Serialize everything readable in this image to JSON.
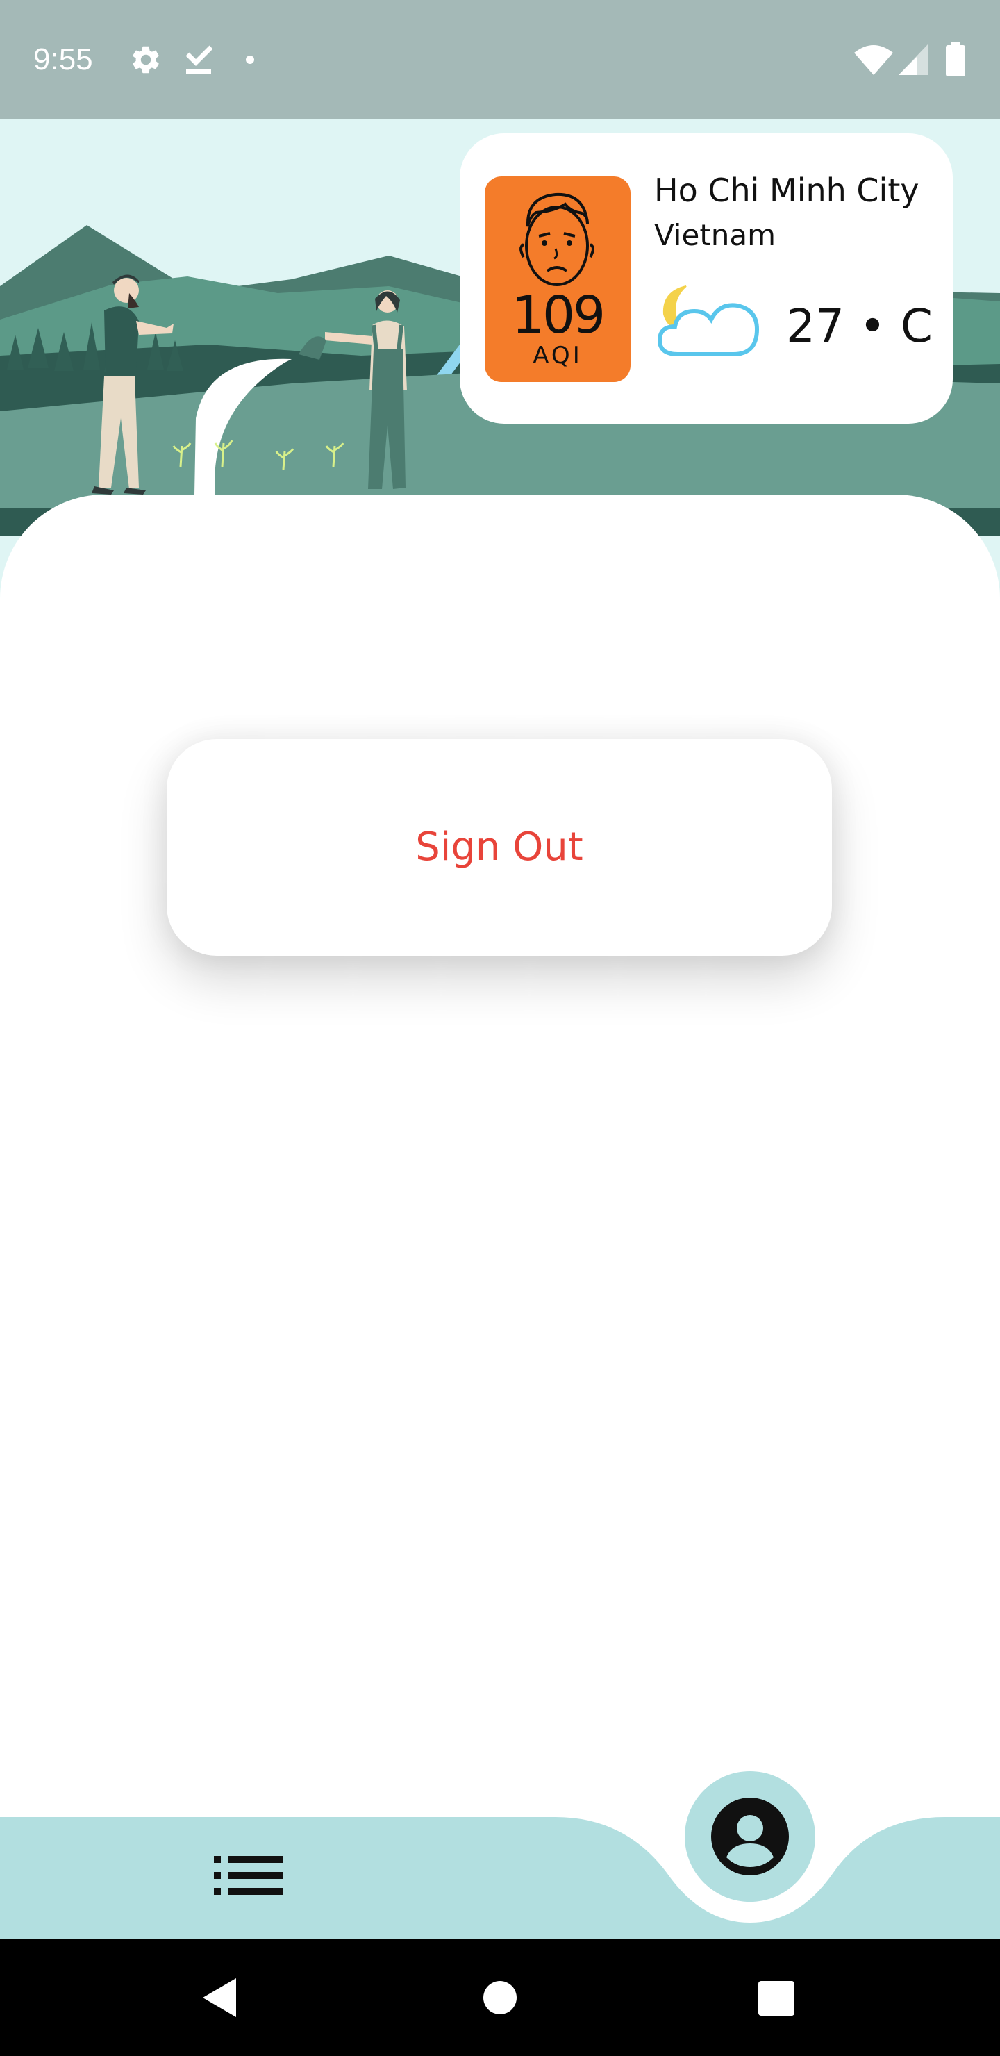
{
  "status_bar": {
    "time": "9:55",
    "icons": [
      "settings-icon",
      "checkmark-download-icon",
      "notification-dot-icon",
      "wifi-icon",
      "signal-icon",
      "battery-icon"
    ]
  },
  "weather": {
    "aqi_value": "109",
    "aqi_label": "AQI",
    "aqi_color": "#f47c2a",
    "city": "Ho Chi Minh City",
    "country": "Vietnam",
    "temperature": "27 • C",
    "condition_icon": "moon-cloud-icon"
  },
  "actions": {
    "sign_out_label": "Sign Out",
    "sign_out_color": "#e8443a"
  },
  "bottom_nav": {
    "items": [
      "list-icon",
      "profile-icon"
    ],
    "background_color": "#b2dfe0"
  },
  "system_nav": {
    "buttons": [
      "back-icon",
      "home-icon",
      "recents-icon"
    ]
  },
  "colors": {
    "status_bar": "#a4b9b7",
    "mountain_green": "#5c9a88"
  }
}
